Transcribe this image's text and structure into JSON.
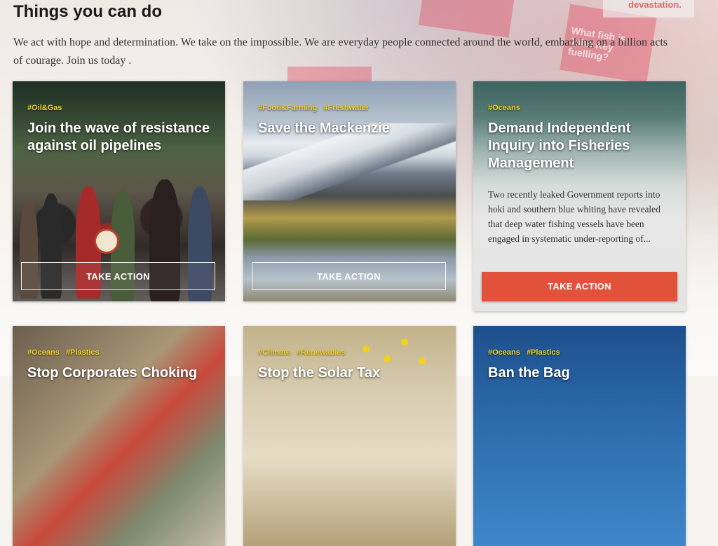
{
  "header": {
    "title": "Things you can do",
    "intro": "We act with hope and determination. We take on the impossible. We are everyday people connected around the world, embarking on a billion acts of courage. Join us today ."
  },
  "background": {
    "sign1": "devastation.",
    "sign2": "What fish is John Key fuelling?"
  },
  "cards": [
    {
      "tags": [
        "#Oil&Gas"
      ],
      "title": "Join the wave of resistance against oil pipelines",
      "button": "TAKE ACTION"
    },
    {
      "tags": [
        "#Food&Farming",
        "#Freshwater"
      ],
      "title": "Save the Mackenzie",
      "button": "TAKE ACTION"
    },
    {
      "tags": [
        "#Oceans"
      ],
      "title": "Demand Independent Inquiry into Fisheries Management",
      "description": "Two recently leaked Government reports into hoki and southern blue whiting have revealed that deep water fishing vessels have been engaged in systematic under-reporting of...",
      "button": "TAKE ACTION"
    },
    {
      "tags": [
        "#Oceans",
        "#Plastics"
      ],
      "title": "Stop Corporates Choking"
    },
    {
      "tags": [
        "#Climate",
        "#Renewables"
      ],
      "title": "Stop the Solar Tax"
    },
    {
      "tags": [
        "#Oceans",
        "#Plastics"
      ],
      "title": "Ban the Bag"
    }
  ],
  "colors": {
    "accent_button": "#e2523a",
    "tag": "#f2d01e"
  }
}
